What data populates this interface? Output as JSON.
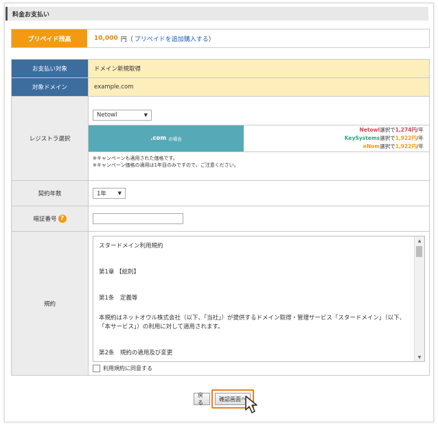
{
  "section_title": "料金お支払い",
  "prepaid": {
    "label": "プリペイド残高",
    "amount": "10,000",
    "unit": "円",
    "link_open": "（",
    "link": "プリペイドを追加購入する",
    "link_close": "）"
  },
  "rows": {
    "payment_target": {
      "label": "お支払い対象",
      "value": "ドメイン新規取得"
    },
    "target_domain": {
      "label": "対象ドメイン",
      "value": "example.com"
    },
    "registrar": {
      "label": "レジストラ選択",
      "selected": "Netowl",
      "com_label": ".com",
      "com_suffix": "の場合",
      "prices": [
        {
          "name": "Netowl",
          "text": "選択で",
          "price": "1,274円",
          "per": "/年",
          "color": "#e03a4e"
        },
        {
          "name": "KeySystems",
          "text": "選択で",
          "price": "1,922円",
          "per": "/年",
          "color": "#2aa37a"
        },
        {
          "name": "eNom",
          "text": "選択で",
          "price": "1,922円",
          "per": "/年",
          "color": "#f39a12"
        }
      ],
      "note1": "※キャンペーンも適用された価格です。",
      "note2": "※キャンペーン価格の適用は1年目のみですので、ご注意ください。"
    },
    "contract_years": {
      "label": "契約年数",
      "selected": "1年"
    },
    "pin": {
      "label": "暗証番号",
      "help": "?"
    },
    "terms": {
      "label": "規約",
      "lines": [
        "スタードメイン利用規約",
        "第1章 【総則】",
        "第1条　定義等",
        "本規約はネットオウル株式会社（以下、「当社」）が提供するドメイン取得・管理サービス「スタードメイン」（以下、「本サービス」）の利用に対して適用されます。",
        "第2条　規約の適用及び変更"
      ],
      "agree": "利用規約に同意する"
    }
  },
  "buttons": {
    "back": "戻る",
    "confirm": "確認画面へ"
  },
  "colors": {
    "accent": "#f39a12",
    "header_blue": "#3c6d9e",
    "highlight": "#fdeebb",
    "com_box": "#56aab7"
  }
}
